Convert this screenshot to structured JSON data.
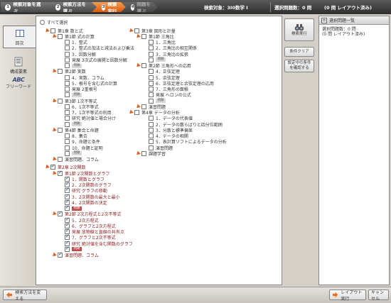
{
  "steps": [
    {
      "num": "1",
      "label": "検索対象を選ぶ"
    },
    {
      "num": "2",
      "label": "検索方法を選ぶ"
    },
    {
      "num": "3",
      "label": "検索実行"
    },
    {
      "num": "4",
      "label": "問題を選ぶ"
    }
  ],
  "topinfo": {
    "search_target": "検索対象：3I0数学 I",
    "selected_count": "選択問題数：0 問",
    "layout_count": "(0 問 レイアウト済み)"
  },
  "leftnav": {
    "toc": "目次",
    "elements": "構成要素",
    "freeword": "フリーワード",
    "abc": "ABC"
  },
  "select_all": "すべて選択",
  "q_tag": "問題",
  "tree_left": [
    {
      "type": "ch",
      "label": "第1章 数と式",
      "checked": false
    },
    {
      "type": "sec",
      "label": "第1節 式の計算",
      "checked": false
    },
    {
      "type": "leaf",
      "label": "1．整式"
    },
    {
      "type": "leaf",
      "label": "2．整式の加法と減法および乗法"
    },
    {
      "type": "leaf",
      "label": "3．因数分解"
    },
    {
      "type": "leaf",
      "label": "発展 3次式の展開と因数分解"
    },
    {
      "type": "q"
    },
    {
      "type": "sec",
      "label": "第2節 実数",
      "checked": false
    },
    {
      "type": "leaf",
      "label": "4．実数、コラム"
    },
    {
      "type": "leaf",
      "label": "5．根号を含む式の計算"
    },
    {
      "type": "leaf",
      "label": "発展 2重根号"
    },
    {
      "type": "q"
    },
    {
      "type": "sec",
      "label": "第3節 1次不等式",
      "checked": false
    },
    {
      "type": "leaf",
      "label": "6．1次不等式"
    },
    {
      "type": "leaf",
      "label": "7．1次不等式の利用"
    },
    {
      "type": "leaf",
      "label": "研究 絶対値と場合分け"
    },
    {
      "type": "q"
    },
    {
      "type": "sec",
      "label": "第4節 集合と命題",
      "checked": false
    },
    {
      "type": "leaf",
      "label": "8．集合"
    },
    {
      "type": "leaf",
      "label": "9．命題と条件"
    },
    {
      "type": "leaf",
      "label": "10．命題と証明"
    },
    {
      "type": "q"
    },
    {
      "type": "sec",
      "label": "演習問題、コラム",
      "checked": false
    },
    {
      "type": "ch",
      "label": "第2章 2次関数",
      "checked": true
    },
    {
      "type": "sec",
      "label": "第1節 2次関数とグラフ",
      "checked": true
    },
    {
      "type": "leaf",
      "label": "1．関数とグラフ",
      "checked": true
    },
    {
      "type": "leaf",
      "label": "2．2次関数のグラフ",
      "checked": true
    },
    {
      "type": "leaf",
      "label": "研究 グラフの移動",
      "checked": true
    },
    {
      "type": "leaf",
      "label": "3．2次関数の最大と最小",
      "checked": true
    },
    {
      "type": "leaf",
      "label": "4．2次関数の決定",
      "checked": true
    },
    {
      "type": "q",
      "checked": true
    },
    {
      "type": "sec",
      "label": "第2節 2次方程式と2次不等式",
      "checked": true
    },
    {
      "type": "leaf",
      "label": "5．2次方程式",
      "checked": true
    },
    {
      "type": "leaf",
      "label": "6．グラフと2次方程式",
      "checked": true
    },
    {
      "type": "leaf",
      "label": "発展 放物線と直線の共有点",
      "checked": true
    },
    {
      "type": "leaf",
      "label": "7．グラフと2次不等式",
      "checked": true
    },
    {
      "type": "leaf",
      "label": "研究 絶対値を含む関数のグラフ",
      "checked": true
    },
    {
      "type": "q",
      "checked": true
    },
    {
      "type": "sec",
      "label": "演習問題、コラム",
      "checked": true
    }
  ],
  "tree_right": [
    {
      "type": "ch",
      "label": "第3章 図形と計量",
      "checked": false
    },
    {
      "type": "sec",
      "label": "第1節 三角比",
      "checked": false
    },
    {
      "type": "leaf",
      "label": "1．三角比"
    },
    {
      "type": "leaf",
      "label": "2．三角比の相互関係"
    },
    {
      "type": "leaf",
      "label": "3．三角比の拡張"
    },
    {
      "type": "q"
    },
    {
      "type": "sec",
      "label": "第2節 三角形への応用",
      "checked": false
    },
    {
      "type": "leaf",
      "label": "4．正弦定理"
    },
    {
      "type": "leaf",
      "label": "5．余弦定理"
    },
    {
      "type": "leaf",
      "label": "6．正弦定理と余弦定理の応用"
    },
    {
      "type": "leaf",
      "label": "7．三角形の面積"
    },
    {
      "type": "leaf",
      "label": "発展 ヘロンの公式"
    },
    {
      "type": "q"
    },
    {
      "type": "sec",
      "label": "演習問題",
      "checked": false
    },
    {
      "type": "ch",
      "label": "第4章 データの分析",
      "checked": false
    },
    {
      "type": "leaf",
      "label": "1．データの代表値"
    },
    {
      "type": "leaf",
      "label": "2．データの散らばりと四分位範囲"
    },
    {
      "type": "leaf",
      "label": "3．分散と標準偏差"
    },
    {
      "type": "leaf",
      "label": "4．データの相関"
    },
    {
      "type": "leaf",
      "label": "5．表計算ソフトによるデータの分析"
    },
    {
      "type": "leaf",
      "label": "演習問題"
    },
    {
      "type": "sec",
      "label": "課題学習",
      "checked": false
    }
  ],
  "buttons": {
    "search_run": "検索実行",
    "clear": "条件クリア",
    "confirm_1": "設定中の条件",
    "confirm_2": "を確認する"
  },
  "rpanel": {
    "title": "選択問題一覧",
    "count": "選択問題数：0 問",
    "layout": "(0 問 レイアウト済み)"
  },
  "bottom": {
    "back": "検索方法を変える",
    "layout": "レイアウト実行",
    "cancel": "キャンセル"
  }
}
